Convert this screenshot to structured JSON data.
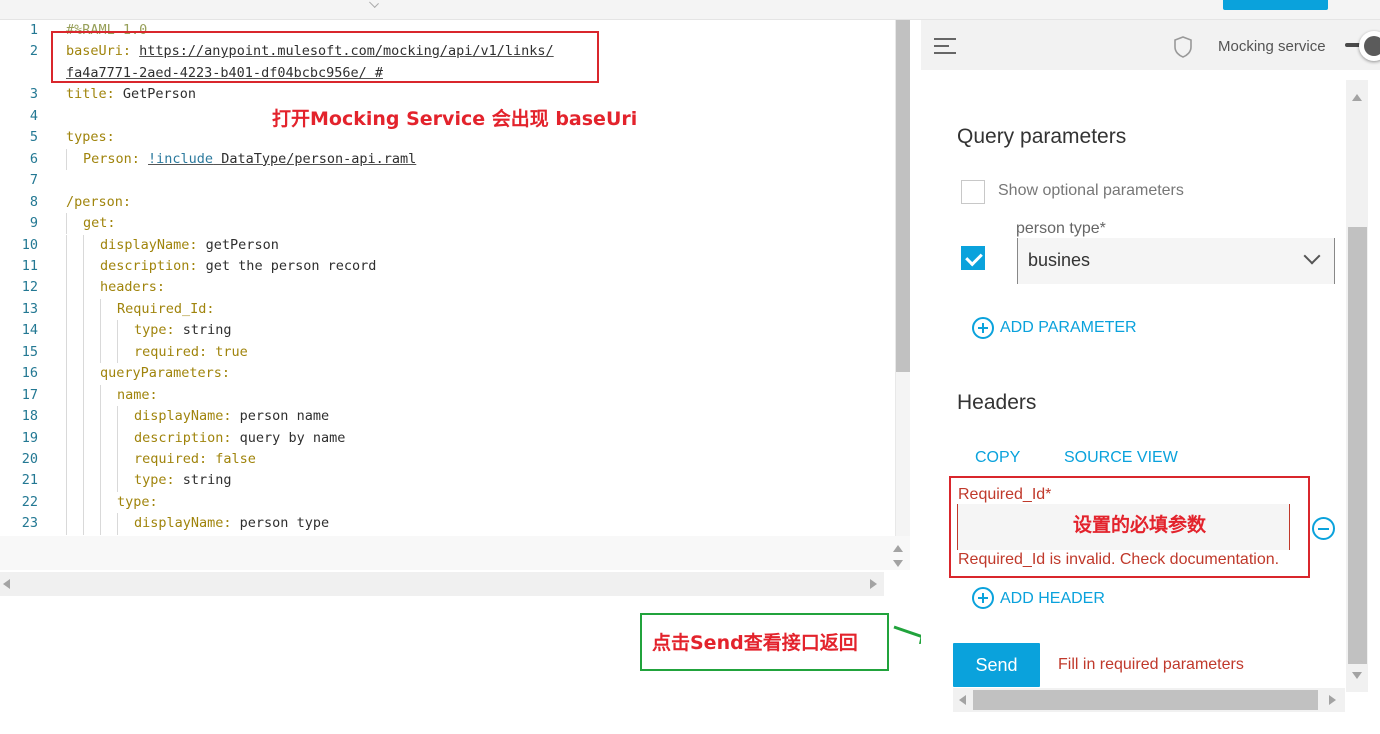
{
  "colors": {
    "accent": "#0aa2dc",
    "error": "#c0392b",
    "annotation_red": "#e3232c",
    "annotation_green": "#21a33c"
  },
  "editor": {
    "lines": [
      {
        "n": "1",
        "indent": 0,
        "parts": [
          {
            "t": "#%RAML 1.0",
            "c": "c"
          }
        ]
      },
      {
        "n": "2",
        "indent": 0,
        "parts": [
          {
            "t": "baseUri: ",
            "c": "k"
          },
          {
            "t": "https://anypoint.mulesoft.com/mocking/api/v1/links/",
            "c": "v ul"
          }
        ]
      },
      {
        "n": "",
        "indent": 0,
        "parts": [
          {
            "t": "fa4a7771-2aed-4223-b401-df04bcbc956e/ #",
            "c": "v ul"
          }
        ]
      },
      {
        "n": "3",
        "indent": 0,
        "parts": [
          {
            "t": "title: ",
            "c": "k"
          },
          {
            "t": "GetPerson",
            "c": "v"
          }
        ]
      },
      {
        "n": "4",
        "indent": 0,
        "parts": []
      },
      {
        "n": "5",
        "indent": 0,
        "parts": [
          {
            "t": "types:",
            "c": "k"
          }
        ]
      },
      {
        "n": "6",
        "indent": 1,
        "parts": [
          {
            "t": "Person: ",
            "c": "k"
          },
          {
            "t": "!include",
            "c": "kw ul"
          },
          {
            "t": " DataType/person-api.raml",
            "c": "v ul"
          }
        ]
      },
      {
        "n": "7",
        "indent": 0,
        "parts": []
      },
      {
        "n": "8",
        "indent": 0,
        "parts": [
          {
            "t": "/person:",
            "c": "k"
          }
        ]
      },
      {
        "n": "9",
        "indent": 1,
        "parts": [
          {
            "t": "get:",
            "c": "k"
          }
        ]
      },
      {
        "n": "10",
        "indent": 2,
        "parts": [
          {
            "t": "displayName: ",
            "c": "k"
          },
          {
            "t": "getPerson",
            "c": "v"
          }
        ]
      },
      {
        "n": "11",
        "indent": 2,
        "parts": [
          {
            "t": "description: ",
            "c": "k"
          },
          {
            "t": "get the person record",
            "c": "v"
          }
        ]
      },
      {
        "n": "12",
        "indent": 2,
        "parts": [
          {
            "t": "headers:",
            "c": "k"
          }
        ]
      },
      {
        "n": "13",
        "indent": 3,
        "parts": [
          {
            "t": "Required_Id:",
            "c": "k"
          }
        ]
      },
      {
        "n": "14",
        "indent": 4,
        "parts": [
          {
            "t": "type: ",
            "c": "k"
          },
          {
            "t": "string",
            "c": "v"
          }
        ]
      },
      {
        "n": "15",
        "indent": 4,
        "parts": [
          {
            "t": "required: ",
            "c": "k"
          },
          {
            "t": "true",
            "c": "k"
          }
        ]
      },
      {
        "n": "16",
        "indent": 2,
        "parts": [
          {
            "t": "queryParameters:",
            "c": "k"
          }
        ]
      },
      {
        "n": "17",
        "indent": 3,
        "parts": [
          {
            "t": "name:",
            "c": "k"
          }
        ]
      },
      {
        "n": "18",
        "indent": 4,
        "parts": [
          {
            "t": "displayName: ",
            "c": "k"
          },
          {
            "t": "person name",
            "c": "v"
          }
        ]
      },
      {
        "n": "19",
        "indent": 4,
        "parts": [
          {
            "t": "description: ",
            "c": "k"
          },
          {
            "t": "query by name",
            "c": "v"
          }
        ]
      },
      {
        "n": "20",
        "indent": 4,
        "parts": [
          {
            "t": "required: ",
            "c": "k"
          },
          {
            "t": "false",
            "c": "k"
          }
        ]
      },
      {
        "n": "21",
        "indent": 4,
        "parts": [
          {
            "t": "type: ",
            "c": "k"
          },
          {
            "t": "string",
            "c": "v"
          }
        ]
      },
      {
        "n": "22",
        "indent": 3,
        "parts": [
          {
            "t": "type:",
            "c": "k"
          }
        ]
      },
      {
        "n": "23",
        "indent": 4,
        "parts": [
          {
            "t": "displayName: ",
            "c": "k"
          },
          {
            "t": "person type",
            "c": "v"
          }
        ]
      }
    ]
  },
  "annotations": {
    "baseuri_note": "打开Mocking Service 会出现 baseUri",
    "required_note": "设置的必填参数",
    "send_note": "点击Send查看接口返回"
  },
  "panel": {
    "mocking_label": "Mocking service",
    "query_title": "Query parameters",
    "show_optional_label": "Show optional parameters",
    "param_label": "person type*",
    "param_value": "busines",
    "add_parameter": "ADD PARAMETER",
    "headers_title": "Headers",
    "copy": "COPY",
    "source_view": "SOURCE VIEW",
    "required_label": "Required_Id*",
    "required_error": "Required_Id is invalid. Check documentation.",
    "add_header": "ADD HEADER",
    "send": "Send",
    "send_hint": "Fill in required parameters"
  },
  "icons": [
    "menu-icon",
    "shield-icon",
    "chevron-down-icon",
    "add-circle-icon",
    "remove-circle-icon",
    "arrow-icon"
  ]
}
